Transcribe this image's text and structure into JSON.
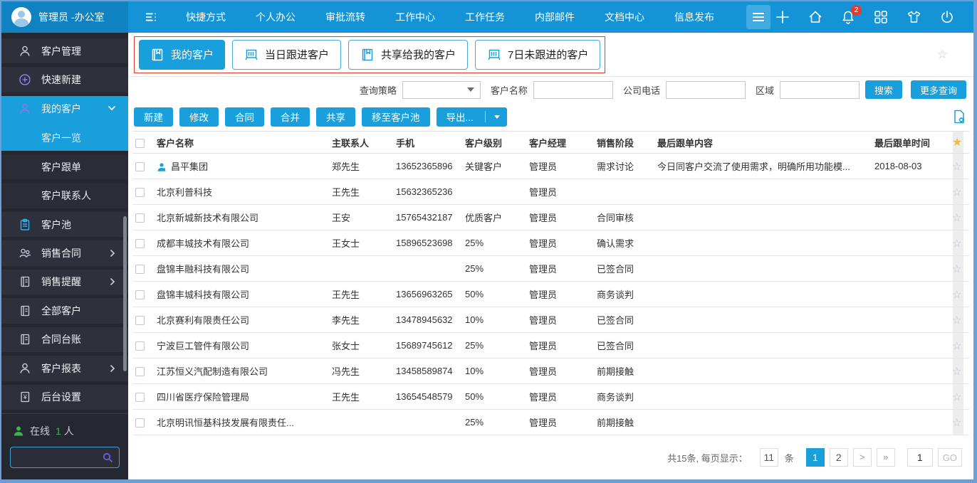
{
  "colors": {
    "topbar": "#1494d6",
    "topbar_left": "#0f83c1",
    "accent": "#189fdc",
    "sidebar": "#252831",
    "red_outline": "#e23b2c",
    "star_gold": "#f3b944",
    "online_green": "#3bb44a",
    "badge_red": "#e8392b"
  },
  "topbar": {
    "user_name": "管理员 -办公室",
    "menu_items": [
      {
        "label": "快捷方式"
      },
      {
        "label": "个人办公"
      },
      {
        "label": "审批流转"
      },
      {
        "label": "工作中心"
      },
      {
        "label": "工作任务"
      },
      {
        "label": "内部邮件"
      },
      {
        "label": "文档中心"
      },
      {
        "label": "信息发布"
      }
    ],
    "notification_count": "2"
  },
  "sidebar": {
    "items": [
      {
        "label": "客户管理"
      },
      {
        "label": "快速新建"
      },
      {
        "label": "我的客户"
      },
      {
        "label": "客户一览"
      },
      {
        "label": "客户跟单"
      },
      {
        "label": "客户联系人"
      },
      {
        "label": "客户池"
      },
      {
        "label": "销售合同"
      },
      {
        "label": "销售提醒"
      },
      {
        "label": "全部客户"
      },
      {
        "label": "合同台账"
      },
      {
        "label": "客户报表"
      },
      {
        "label": "后台设置"
      }
    ],
    "online": {
      "label": "在线",
      "count": "1",
      "unit": "人"
    }
  },
  "tabs": [
    {
      "label": "我的客户"
    },
    {
      "label": "当日跟进客户"
    },
    {
      "label": "共享给我的客户"
    },
    {
      "label": "7日未跟进的客户"
    }
  ],
  "filters": {
    "strategy_label": "查询策略",
    "name_label": "客户名称",
    "phone_label": "公司电话",
    "region_label": "区域",
    "search_button": "搜索",
    "more_button": "更多查询"
  },
  "toolbar": {
    "buttons": [
      {
        "label": "新建"
      },
      {
        "label": "修改"
      },
      {
        "label": "合同"
      },
      {
        "label": "合并"
      },
      {
        "label": "共享"
      },
      {
        "label": "移至客户池"
      }
    ],
    "export_label": "导出..."
  },
  "table": {
    "columns": [
      "客户名称",
      "主联系人",
      "手机",
      "客户级别",
      "客户经理",
      "销售阶段",
      "最后跟单内容",
      "最后跟单时间"
    ],
    "rows": [
      {
        "has_icon": true,
        "name": "昌平集团",
        "contact": "郑先生",
        "mobile": "13652365896",
        "level": "关键客户",
        "manager": "管理员",
        "stage": "需求讨论",
        "last_content": "今日同客户交流了使用需求，明确所用功能模...",
        "last_time": "2018-08-03"
      },
      {
        "has_icon": false,
        "name": "北京利普科技",
        "contact": "王先生",
        "mobile": "15632365236",
        "level": "",
        "manager": "管理员",
        "stage": "",
        "last_content": "",
        "last_time": ""
      },
      {
        "has_icon": false,
        "name": "北京新城新技术有限公司",
        "contact": "王安",
        "mobile": "15765432187",
        "level": "优质客户",
        "manager": "管理员",
        "stage": "合同审核",
        "last_content": "",
        "last_time": ""
      },
      {
        "has_icon": false,
        "name": "成都丰城技术有限公司",
        "contact": "王女士",
        "mobile": "15896523698",
        "level": "25%",
        "manager": "管理员",
        "stage": "确认需求",
        "last_content": "",
        "last_time": ""
      },
      {
        "has_icon": false,
        "name": "盘锦丰融科技有限公司",
        "contact": "",
        "mobile": "",
        "level": "25%",
        "manager": "管理员",
        "stage": "已签合同",
        "last_content": "",
        "last_time": ""
      },
      {
        "has_icon": false,
        "name": "盘锦丰城科技有限公司",
        "contact": "王先生",
        "mobile": "13656963265",
        "level": "50%",
        "manager": "管理员",
        "stage": "商务谈判",
        "last_content": "",
        "last_time": ""
      },
      {
        "has_icon": false,
        "name": "北京赛利有限责任公司",
        "contact": "李先生",
        "mobile": "13478945632",
        "level": "10%",
        "manager": "管理员",
        "stage": "已签合同",
        "last_content": "",
        "last_time": ""
      },
      {
        "has_icon": false,
        "name": "宁波巨工管件有限公司",
        "contact": "张女士",
        "mobile": "15689745612",
        "level": "25%",
        "manager": "管理员",
        "stage": "已签合同",
        "last_content": "",
        "last_time": ""
      },
      {
        "has_icon": false,
        "name": "江苏恒义汽配制造有限公司",
        "contact": "冯先生",
        "mobile": "13458589874",
        "level": "10%",
        "manager": "管理员",
        "stage": "前期接触",
        "last_content": "",
        "last_time": ""
      },
      {
        "has_icon": false,
        "name": "四川省医疗保险管理局",
        "contact": "王先生",
        "mobile": "13654548579",
        "level": "50%",
        "manager": "管理员",
        "stage": "商务谈判",
        "last_content": "",
        "last_time": ""
      },
      {
        "has_icon": false,
        "name": "北京明讯恒基科技发展有限责任...",
        "contact": "",
        "mobile": "",
        "level": "25%",
        "manager": "管理员",
        "stage": "前期接触",
        "last_content": "",
        "last_time": ""
      }
    ]
  },
  "pagination": {
    "total_text": "共15条, 每页显示：",
    "page_size": "11",
    "unit": "条",
    "pages": [
      "1",
      "2"
    ],
    "next": ">",
    "last": "»",
    "goto_value": "1",
    "go_label": "GO"
  }
}
